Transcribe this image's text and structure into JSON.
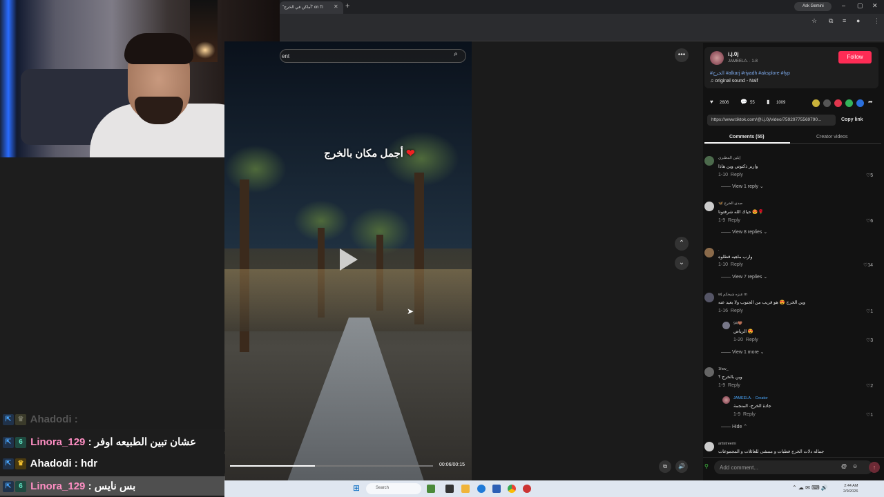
{
  "browser": {
    "tab_title": "\"أماكن في الخرج\" on Ti",
    "new_tab": "+",
    "ask_gemini": "Ask Gemini",
    "window_controls": [
      "–",
      "▢",
      "✕"
    ]
  },
  "video": {
    "search_placeholder": "ent",
    "overlay_text": "أجمل مكان بالخرج",
    "heart": "❤",
    "timecode": "00:06/00:15",
    "progress": 0.42
  },
  "author": {
    "username": "i.j.0j",
    "display_and_date": "JAMEELA. · 1-8",
    "follow_label": "Follow",
    "hashtags": "#الخرج #alkarj #riyadh #aksplore #fyp",
    "sound": "original sound - Naif",
    "likes": "2606",
    "comments": "55",
    "saves": "1009",
    "link": "https://www.tiktok.com/@i.j.0j/video/75929775569790...",
    "copy_link": "Copy link"
  },
  "tabs": {
    "comments": "Comments (55)",
    "creator_videos": "Creator videos"
  },
  "comments": [
    {
      "name": "إيلين المطيري",
      "text": "وارير ذكتوتي وين هاذا",
      "date": "1-10",
      "reply": "Reply",
      "likes": "5",
      "view_replies": "View 1 reply"
    },
    {
      "name": "🦋 صدى الخرج",
      "text": "حياك الله شرفتونا 😍🌹",
      "date": "1-9",
      "reply": "Reply",
      "likes": "6",
      "view_replies": "View 8 replies"
    },
    {
      "name": ".",
      "text": "وارب ماهيه قطلوه",
      "date": "1-10",
      "reply": "Reply",
      "likes": "14",
      "view_replies": "View 7 replies"
    },
    {
      "name": "w| عنزه شيخكم m",
      "text": "وين الخرج 😍 هو قريب من الجنوب ولا بعيد عنه",
      "date": "1-16",
      "reply": "Reply",
      "likes": "1",
      "view_replies": ""
    },
    {
      "name": "94🤎",
      "text": "الرياض 😍",
      "date": "1-20",
      "reply": "Reply",
      "likes": "3",
      "view_replies": "View 1 more"
    },
    {
      "name": "1faw_",
      "text": "وين بالخرج ؟",
      "date": "1-9",
      "reply": "Reply",
      "likes": "2",
      "view_replies": ""
    },
    {
      "name": "JAMEELA. · Creator",
      "text": "جادة الخرج- المنجمة",
      "date": "1-9",
      "reply": "Reply",
      "likes": "1",
      "view_replies": "Hide"
    },
    {
      "name": "artistreemi",
      "text": "جماله دلات الخرج فطبات و ممشى للعائلات و المجموعات",
      "date": "",
      "reply": "",
      "likes": "",
      "view_replies": ""
    }
  ],
  "comment_input": {
    "placeholder": "Add comment..."
  },
  "chat": [
    {
      "user": "Ahadodi",
      "message": ""
    },
    {
      "user": "Linora_129",
      "message": "عشان تبين الطبيعه اوفر"
    },
    {
      "user": "Ahadodi",
      "message": "hdr"
    },
    {
      "user": "Linora_129",
      "message": "بس نايس"
    }
  ],
  "taskbar": {
    "search": "Search",
    "time": "2:44 AM",
    "date": "2/9/2026"
  },
  "colors": {
    "follow": "#fe2c55",
    "chat_user_pink": "#ff8fc4",
    "hashtags": "#7aa6e6"
  }
}
